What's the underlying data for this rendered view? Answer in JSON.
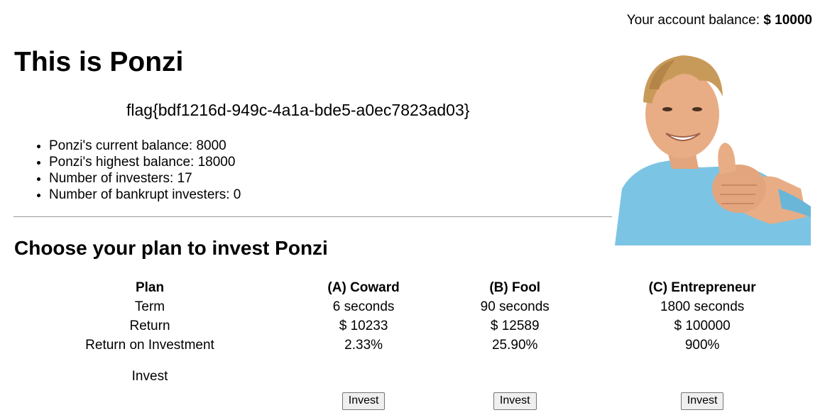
{
  "header": {
    "balance_label": "Your account balance:",
    "balance_value": "$ 10000"
  },
  "page": {
    "title": "This is Ponzi",
    "flag": "flag{bdf1216d-949c-4a1a-bde5-a0ec7823ad03}"
  },
  "stats": [
    "Ponzi's current balance: 8000",
    "Ponzi's highest balance: 18000",
    "Number of investers: 17",
    "Number of bankrupt investers: 0"
  ],
  "section": {
    "title": "Choose your plan to invest Ponzi"
  },
  "plans_table": {
    "header": [
      "Plan",
      "(A) Coward",
      "(B) Fool",
      "(C) Entrepreneur"
    ],
    "rows": [
      [
        "Term",
        "6 seconds",
        "90 seconds",
        "1800 seconds"
      ],
      [
        "Return",
        "$ 10233",
        "$ 12589",
        "$ 100000"
      ],
      [
        "Return on Investment",
        "2.33%",
        "25.90%",
        "900%"
      ]
    ],
    "invest_label": "Invest",
    "buttons": [
      "Invest",
      "Invest",
      "Invest"
    ]
  },
  "image": {
    "icon": "thumbs-up-man-photo",
    "shirt_color": "#7cc4e4",
    "skin_color": "#e8a87c",
    "hair_color": "#c89a5a"
  }
}
